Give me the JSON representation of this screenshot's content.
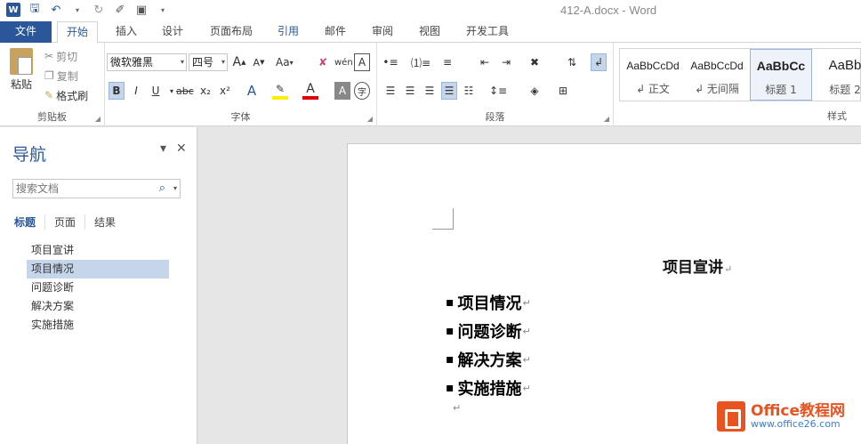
{
  "window": {
    "title": "412-A.docx - Word"
  },
  "qat": {
    "undo_arrow": "▾"
  },
  "tabs": [
    "文件",
    "开始",
    "插入",
    "设计",
    "页面布局",
    "引用",
    "邮件",
    "审阅",
    "视图",
    "开发工具"
  ],
  "clipboard": {
    "paste": "粘贴",
    "cut": "剪切",
    "copy": "复制",
    "format_painter": "格式刷",
    "label": "剪贴板"
  },
  "font": {
    "name": "微软雅黑",
    "size": "四号",
    "label": "字体",
    "bold": "B",
    "italic": "I",
    "underline": "U",
    "strike": "abc",
    "sub": "x₂",
    "sup": "x²",
    "grow": "A",
    "shrink": "A",
    "case": "Aa",
    "color_a": "A"
  },
  "paragraph": {
    "label": "段落"
  },
  "styles": {
    "label": "样式",
    "items": [
      {
        "sample": "AaBbCcDd",
        "name": "↲ 正文"
      },
      {
        "sample": "AaBbCcDd",
        "name": "↲ 无间隔"
      },
      {
        "sample": "AaBbCc",
        "name": "标题 1"
      },
      {
        "sample": "AaBb",
        "name": "标题 2"
      }
    ]
  },
  "nav": {
    "title": "导航",
    "search_placeholder": "搜索文档",
    "tabs": [
      "标题",
      "页面",
      "结果"
    ],
    "items": [
      "项目宣讲",
      "项目情况",
      "问题诊断",
      "解决方案",
      "实施措施"
    ],
    "selected_index": 1
  },
  "document": {
    "title": "项目宣讲",
    "paragraph_mark": "↵",
    "bullets": [
      "项目情况",
      "问题诊断",
      "解决方案",
      "实施措施"
    ]
  },
  "watermark": {
    "line1": "Office教程网",
    "line2": "www.office26.com"
  },
  "colors": {
    "accent": "#2b579a",
    "selection": "#c5d5ea",
    "watermark": "#e8541f"
  }
}
